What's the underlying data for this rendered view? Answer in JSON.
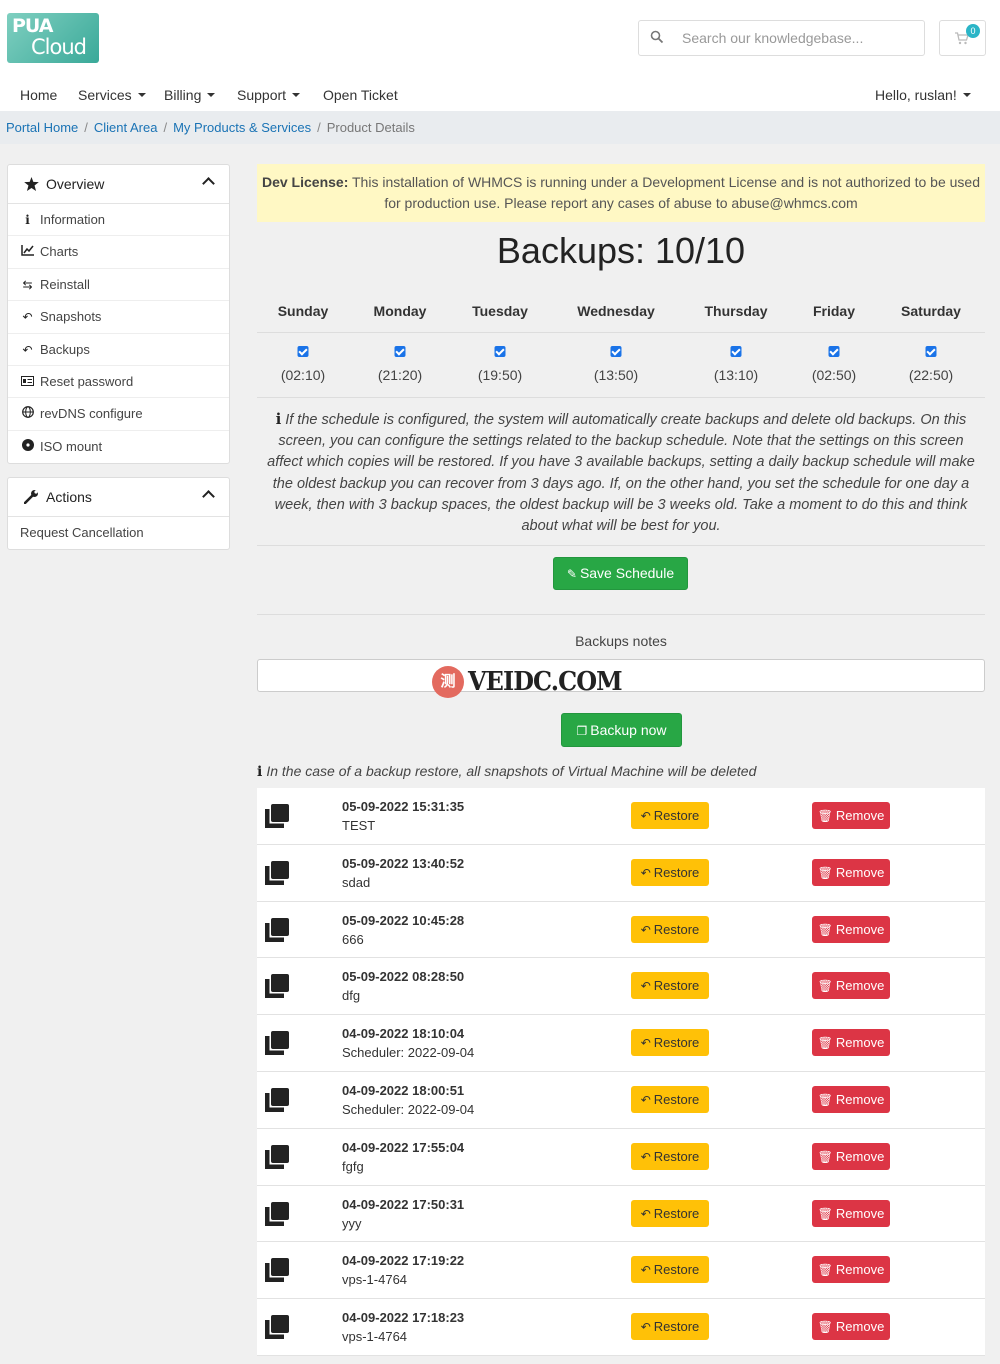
{
  "header": {
    "logo_line1": "PUA",
    "logo_line2": "Cloud",
    "search_placeholder": "Search our knowledgebase...",
    "cart_count": "0"
  },
  "nav": {
    "home": "Home",
    "services": "Services",
    "billing": "Billing",
    "support": "Support",
    "open_ticket": "Open Ticket",
    "user": "Hello, ruslan!"
  },
  "breadcrumb": [
    "Portal Home",
    "Client Area",
    "My Products & Services",
    "Product Details"
  ],
  "sidebar": {
    "overview": {
      "title": "Overview",
      "items": [
        {
          "label": "Information",
          "icon": "info-icon"
        },
        {
          "label": "Charts",
          "icon": "chart-icon"
        },
        {
          "label": "Reinstall",
          "icon": "retweet-icon"
        },
        {
          "label": "Snapshots",
          "icon": "reply-icon"
        },
        {
          "label": "Backups",
          "icon": "reply-all-icon"
        },
        {
          "label": "Reset password",
          "icon": "id-card-icon"
        },
        {
          "label": "revDNS configure",
          "icon": "globe-icon"
        },
        {
          "label": "ISO mount",
          "icon": "disc-icon"
        }
      ]
    },
    "actions": {
      "title": "Actions",
      "items": [
        {
          "label": "Request Cancellation"
        }
      ]
    }
  },
  "alert": {
    "bold": "Dev License:",
    "text": " This installation of WHMCS is running under a Development License and is not authorized to be used for production use. Please report any cases of abuse to abuse@whmcs.com"
  },
  "backups_title": "Backups: 10/10",
  "schedule": [
    {
      "day": "Sunday",
      "time": "(02:10)",
      "checked": true
    },
    {
      "day": "Monday",
      "time": "(21:20)",
      "checked": true
    },
    {
      "day": "Tuesday",
      "time": "(19:50)",
      "checked": true
    },
    {
      "day": "Wednesday",
      "time": "(13:50)",
      "checked": true
    },
    {
      "day": "Thursday",
      "time": "(13:10)",
      "checked": true
    },
    {
      "day": "Friday",
      "time": "(02:50)",
      "checked": true
    },
    {
      "day": "Saturday",
      "time": "(22:50)",
      "checked": true
    }
  ],
  "schedule_info": "If the schedule is configured, the system will automatically create backups and delete old backups. On this screen, you can configure the settings related to the backup schedule. Note that the settings on this screen affect which copies will be restored. If you have 3 available backups, setting a daily backup schedule will make the oldest backup you can recover from 3 days ago. If, on the other hand, you set the schedule for one day a week, then with 3 backup spaces, the oldest backup will be 3 weeks old. Take a moment to do this and think about what will be best for you.",
  "save_schedule_label": "Save Schedule",
  "notes_label": "Backups notes",
  "notes_value": "",
  "watermark": {
    "badge": "测",
    "text": "VEIDC.COM"
  },
  "backup_now_label": "Backup now",
  "restore_note": "In the case of a backup restore, all snapshots of Virtual Machine will be deleted",
  "restore_label": "Restore",
  "remove_label": "Remove",
  "backups": [
    {
      "date": "05-09-2022 15:31:35",
      "note": "TEST"
    },
    {
      "date": "05-09-2022 13:40:52",
      "note": "sdad"
    },
    {
      "date": "05-09-2022 10:45:28",
      "note": "666"
    },
    {
      "date": "05-09-2022 08:28:50",
      "note": "dfg"
    },
    {
      "date": "04-09-2022 18:10:04",
      "note": "Scheduler: 2022-09-04"
    },
    {
      "date": "04-09-2022 18:00:51",
      "note": "Scheduler: 2022-09-04"
    },
    {
      "date": "04-09-2022 17:55:04",
      "note": "fgfg"
    },
    {
      "date": "04-09-2022 17:50:31",
      "note": "yyy"
    },
    {
      "date": "04-09-2022 17:19:22",
      "note": "vps-1-4764"
    },
    {
      "date": "04-09-2022 17:18:23",
      "note": "vps-1-4764"
    }
  ]
}
